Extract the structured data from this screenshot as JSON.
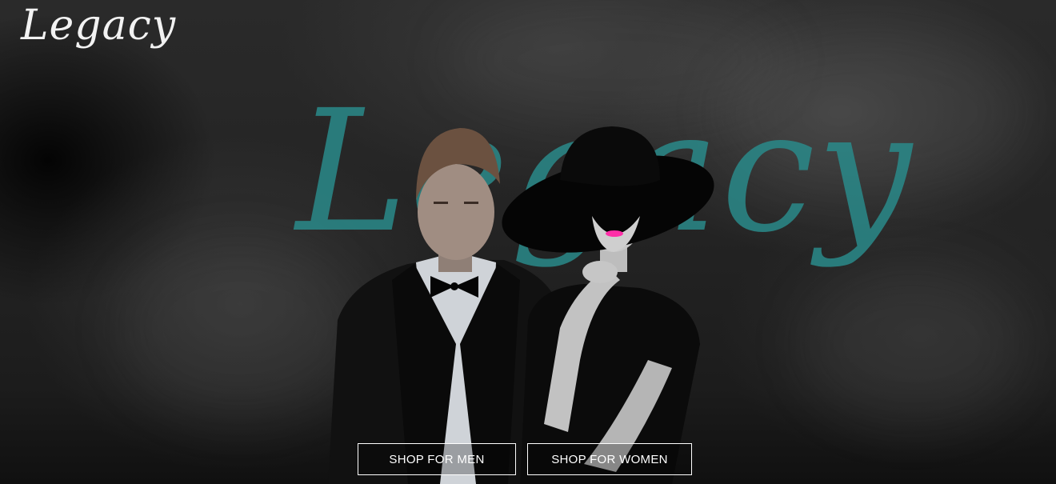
{
  "brand": {
    "logo_text": "Legacy",
    "hero_script_text": "Legacy",
    "accent_color": "#2a8a8a",
    "lip_color": "#ff2fa8"
  },
  "hero": {
    "image_description": "man-in-tuxedo-and-woman-in-black-hat"
  },
  "cta": {
    "men_label": "SHOP FOR MEN",
    "women_label": "SHOP FOR WOMEN"
  }
}
